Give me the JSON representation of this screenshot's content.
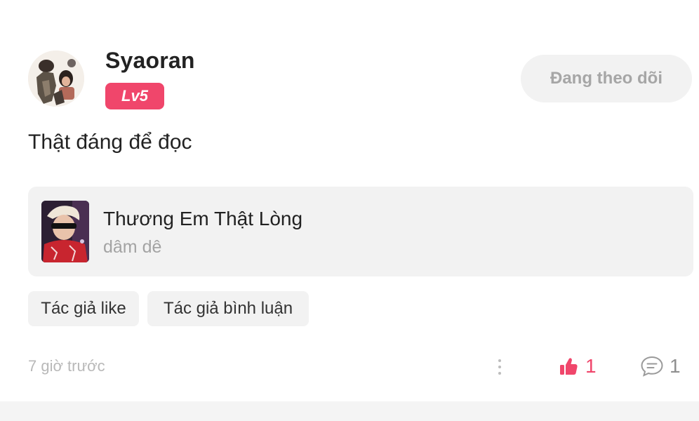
{
  "post": {
    "user": {
      "name": "Syaoran",
      "level": "Lv5",
      "follow_label": "Đang theo dõi"
    },
    "comment": "Thật đáng để đọc",
    "book": {
      "title": "Thương Em Thật Lòng",
      "author": "dâm dê"
    },
    "tags": [
      "Tác giả like",
      "Tác giả bình luận"
    ],
    "time": "7 giờ trước",
    "likes": "1",
    "comments": "1"
  },
  "colors": {
    "accent": "#f0466b",
    "muted_text": "#a3a3a3",
    "chip_background": "#f2f2f2"
  },
  "icons": {
    "avatar": "user-avatar-image",
    "cover": "book-cover-image",
    "more": "more-vertical-icon",
    "like": "thumbs-up-icon",
    "comment": "comment-bubble-icon"
  }
}
